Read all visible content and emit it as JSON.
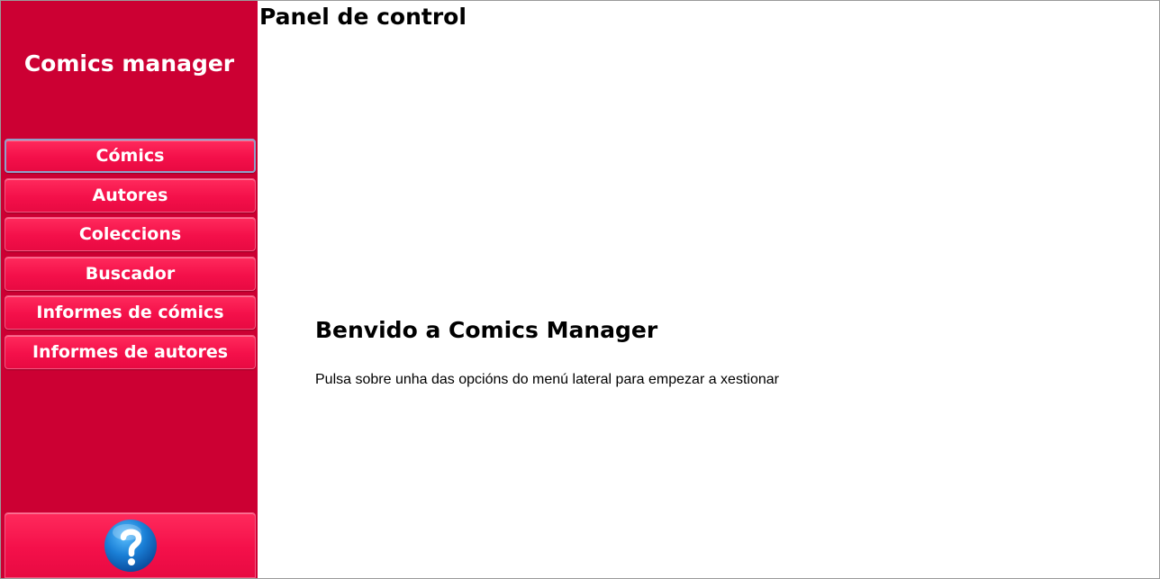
{
  "sidebar": {
    "app_title": "Comics manager",
    "items": [
      {
        "label": "Cómics",
        "active": true
      },
      {
        "label": "Autores"
      },
      {
        "label": "Coleccions"
      },
      {
        "label": "Buscador"
      },
      {
        "label": "Informes de cómics"
      },
      {
        "label": "Informes de autores"
      }
    ],
    "help_icon": "help-question-icon",
    "accent_color": "#cc0033",
    "button_color": "#f4104a"
  },
  "main": {
    "page_title": "Panel de control",
    "welcome_heading": "Benvido a Comics Manager",
    "welcome_text": "Pulsa sobre unha das opcións do menú lateral para empezar a xestionar"
  }
}
